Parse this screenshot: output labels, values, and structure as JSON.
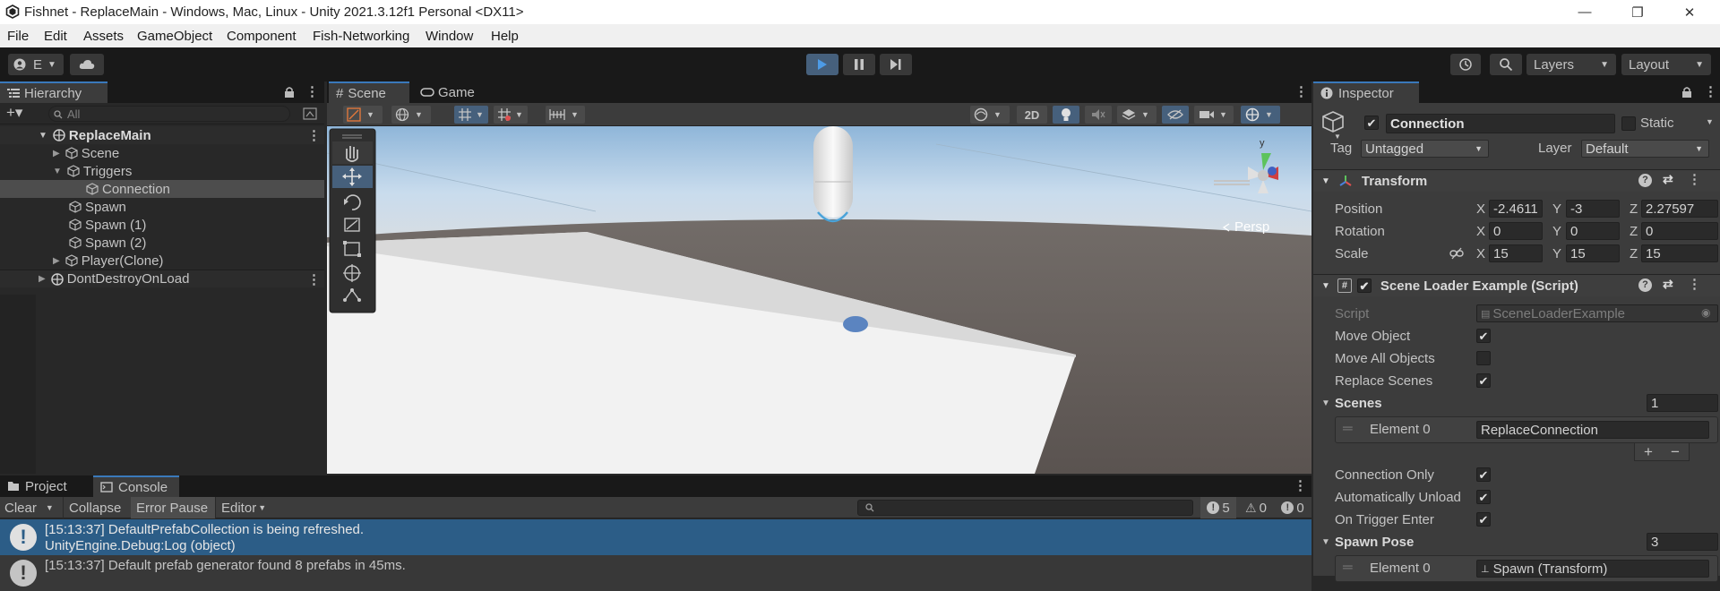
{
  "title_bar": {
    "title": "Fishnet - ReplaceMain - Windows, Mac, Linux - Unity 2021.3.12f1 Personal <DX11>",
    "minimize": "—",
    "maximize": "❐",
    "close": "✕"
  },
  "menu": [
    "File",
    "Edit",
    "Assets",
    "GameObject",
    "Component",
    "Fish-Networking",
    "Window",
    "Help"
  ],
  "toolbar": {
    "account_label": "E",
    "layers_label": "Layers",
    "layout_label": "Layout"
  },
  "hierarchy": {
    "tab_label": "Hierarchy",
    "search_placeholder": "All",
    "items": [
      {
        "label": "ReplaceMain"
      },
      {
        "label": "Scene"
      },
      {
        "label": "Triggers"
      },
      {
        "label": "Connection"
      },
      {
        "label": "Spawn"
      },
      {
        "label": "Spawn (1)"
      },
      {
        "label": "Spawn (2)"
      },
      {
        "label": "Player(Clone)"
      },
      {
        "label": "DontDestroyOnLoad"
      }
    ]
  },
  "scene_view": {
    "tabs": [
      {
        "label": "Scene"
      },
      {
        "label": "Game"
      }
    ],
    "mode_2d": "2D",
    "persp_label": "Persp",
    "gizmo_y": "y"
  },
  "inspector": {
    "tab_label": "Inspector",
    "object_name": "Connection",
    "static_label": "Static",
    "tag_label": "Tag",
    "tag_value": "Untagged",
    "layer_label": "Layer",
    "layer_value": "Default",
    "transform": {
      "title": "Transform",
      "position_label": "Position",
      "position": {
        "x": "-2.4611",
        "y": "-3",
        "z": "2.27597"
      },
      "rotation_label": "Rotation",
      "rotation": {
        "x": "0",
        "y": "0",
        "z": "0"
      },
      "scale_label": "Scale",
      "scale": {
        "x": "15",
        "y": "15",
        "z": "15"
      },
      "axis_x": "X",
      "axis_y": "Y",
      "axis_z": "Z"
    },
    "script_component": {
      "title": "Scene Loader Example (Script)",
      "script_label": "Script",
      "script_value": "SceneLoaderExample",
      "move_object_label": "Move Object",
      "move_object": true,
      "move_all_label": "Move All Objects",
      "move_all": false,
      "replace_scenes_label": "Replace Scenes",
      "replace_scenes": true,
      "scenes_label": "Scenes",
      "scenes_count": "1",
      "element0_label": "Element 0",
      "element0_value": "ReplaceConnection",
      "plus": "+",
      "minus": "−",
      "connection_only_label": "Connection Only",
      "connection_only": true,
      "auto_unload_label": "Automatically Unload",
      "auto_unload": true,
      "on_trigger_label": "On Trigger Enter",
      "on_trigger": true,
      "spawn_pose_label": "Spawn Pose",
      "spawn_pose_count": "3",
      "spawn_element0_label": "Element 0",
      "spawn_element0_value": "Spawn (Transform)"
    }
  },
  "console": {
    "tabs": [
      {
        "label": "Project"
      },
      {
        "label": "Console"
      }
    ],
    "clear_label": "Clear",
    "collapse_label": "Collapse",
    "error_pause_label": "Error Pause",
    "editor_label": "Editor",
    "counts": {
      "log": "5",
      "warn": "0",
      "error": "0"
    },
    "messages": [
      {
        "line1": "[15:13:37] DefaultPrefabCollection is being refreshed.",
        "line2": "UnityEngine.Debug:Log (object)"
      },
      {
        "line1": "[15:13:37] Default prefab generator found 8 prefabs in 45ms.",
        "line2": ""
      }
    ]
  }
}
